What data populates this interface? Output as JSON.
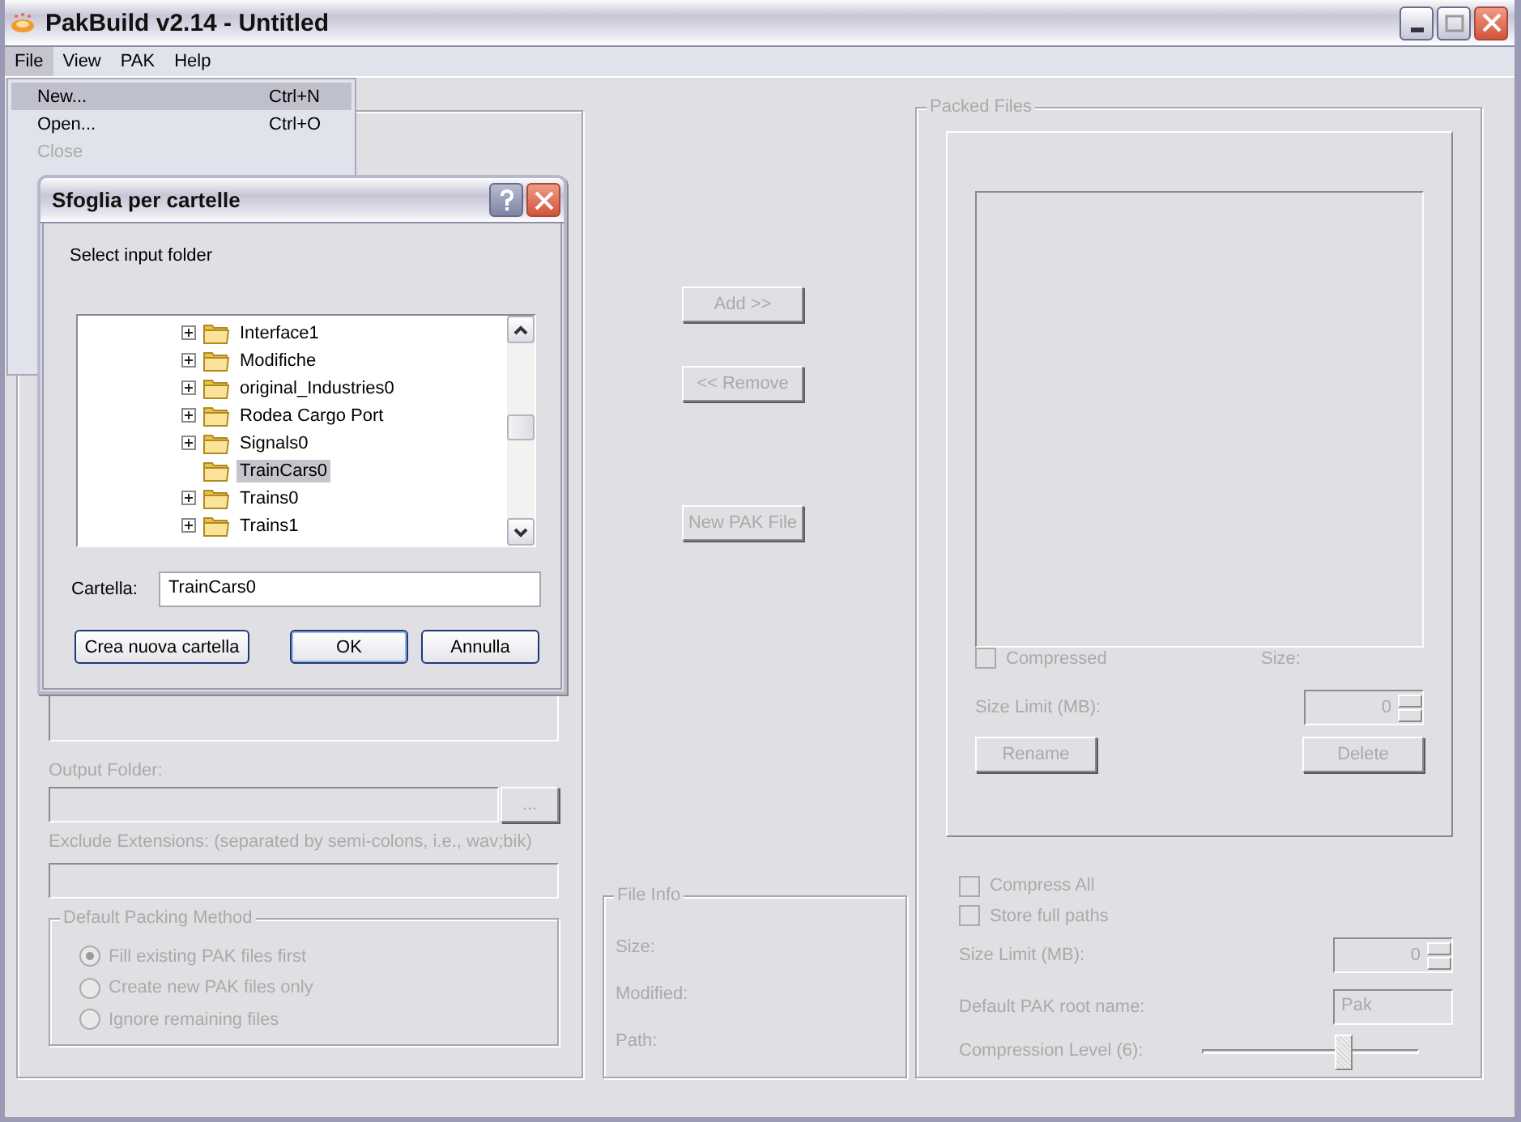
{
  "window": {
    "title": "PakBuild v2.14 - Untitled"
  },
  "menu_bar": [
    {
      "label": "File",
      "selected": true
    },
    {
      "label": "View",
      "selected": false
    },
    {
      "label": "PAK",
      "selected": false
    },
    {
      "label": "Help",
      "selected": false
    }
  ],
  "file_menu": [
    {
      "label": "New...",
      "shortcut": "Ctrl+N",
      "selected": true,
      "disabled": false
    },
    {
      "label": "Open...",
      "shortcut": "Ctrl+O",
      "selected": false,
      "disabled": false
    },
    {
      "label": "Close",
      "selected": false,
      "disabled": true
    }
  ],
  "left_panel": {
    "output_folder_label": "Output Folder:",
    "browse_button": "...",
    "exclude_label": "Exclude Extensions: (separated by semi-colons, i.e., wav;bik)",
    "packing_method": {
      "title": "Default Packing Method",
      "options": [
        {
          "label": "Fill existing PAK files first",
          "selected": true
        },
        {
          "label": "Create new PAK files only",
          "selected": false
        },
        {
          "label": "Ignore remaining files",
          "selected": false
        }
      ]
    }
  },
  "center": {
    "buttons": [
      "Add >>",
      "<< Remove",
      "New PAK File"
    ],
    "file_info": {
      "title": "File Info",
      "fields": [
        "Size:",
        "Modified:",
        "Path:"
      ]
    }
  },
  "packed_files": {
    "title": "Packed Files",
    "compressed": {
      "label": "Compressed",
      "checked": false
    },
    "size_label": "Size:",
    "size_limit_label": "Size Limit (MB):",
    "size_limit_value": "0",
    "rename_button": "Rename",
    "delete_button": "Delete"
  },
  "options": {
    "checkboxes": [
      {
        "label": "Compress All",
        "checked": false
      },
      {
        "label": "Store full paths",
        "checked": false
      }
    ],
    "size_limit_label": "Size Limit (MB):",
    "size_limit_value": "0",
    "root_name_label": "Default PAK root name:",
    "root_name_value": "Pak",
    "compression_label": "Compression Level (6):",
    "compression": {
      "level": 0.65
    }
  },
  "dialog": {
    "title": "Sfoglia per cartelle",
    "prompt": "Select input folder",
    "tree": [
      {
        "label": "Interface1",
        "expandable": true,
        "selected": false
      },
      {
        "label": "Modifiche",
        "expandable": true,
        "selected": false
      },
      {
        "label": "original_Industries0",
        "expandable": true,
        "selected": false
      },
      {
        "label": "Rodea Cargo Port",
        "expandable": true,
        "selected": false
      },
      {
        "label": "Signals0",
        "expandable": true,
        "selected": false
      },
      {
        "label": "TrainCars0",
        "expandable": false,
        "selected": true
      },
      {
        "label": "Trains0",
        "expandable": true,
        "selected": false
      },
      {
        "label": "Trains1",
        "expandable": true,
        "selected": false
      }
    ],
    "folder_label": "Cartella:",
    "folder_value": "TrainCars0",
    "buttons": [
      {
        "label": "Crea nuova cartella",
        "default": false
      },
      {
        "label": "OK",
        "default": true
      },
      {
        "label": "Annulla",
        "default": false
      }
    ]
  }
}
